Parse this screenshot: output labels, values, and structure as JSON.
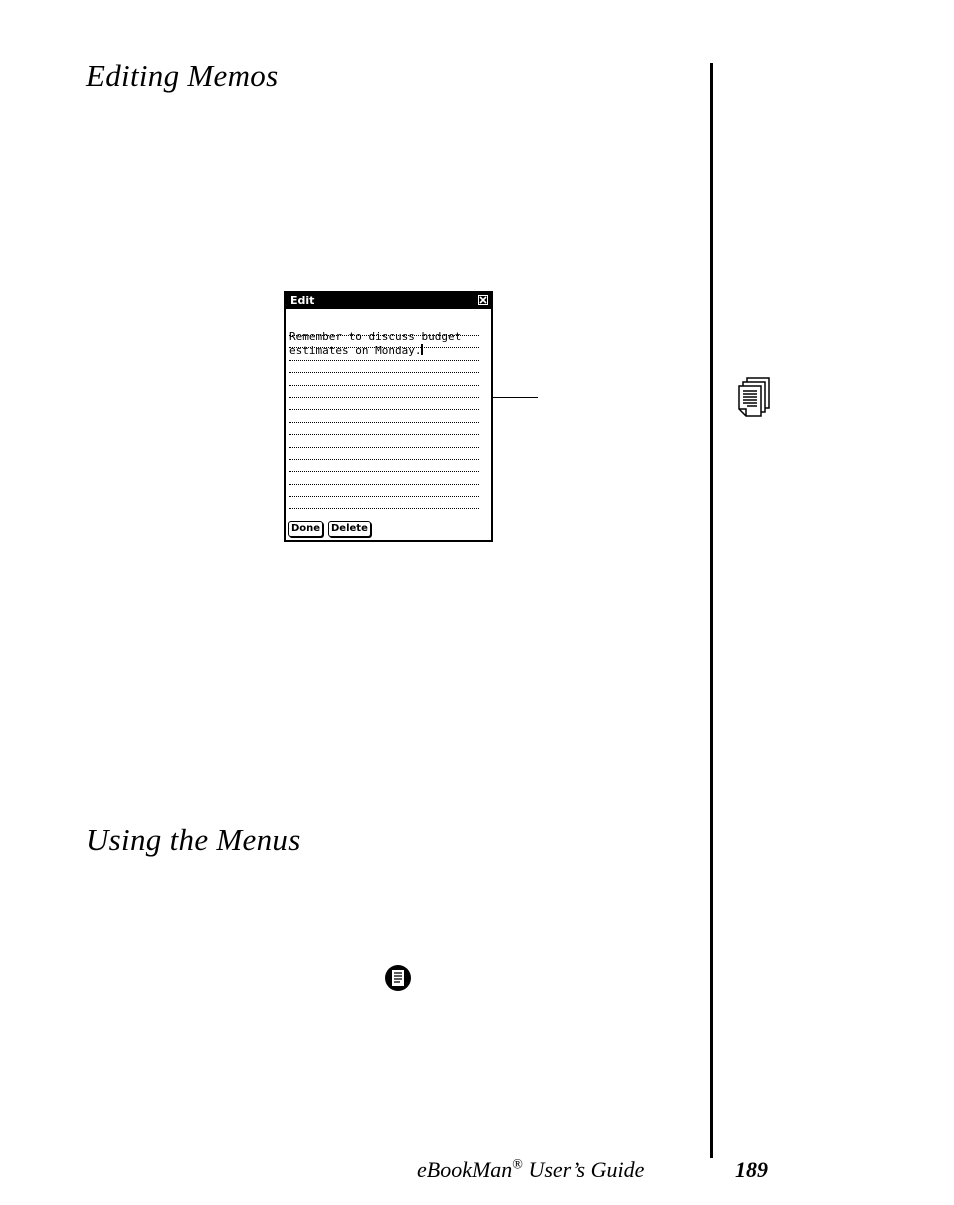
{
  "headings": {
    "editing": "Editing Memos",
    "menus": "Using the Menus"
  },
  "device": {
    "title": "Edit",
    "memo_line1": "Remember to discuss budget",
    "memo_line2": "estimates on Monday.",
    "done_label": "Done",
    "delete_label": "Delete"
  },
  "icons": {
    "doc": "stacked-document-icon",
    "menu": "menu-icon",
    "close": "close-icon"
  },
  "footer": {
    "guide_prefix": "eBookMan",
    "registered": "®",
    "guide_suffix": " User’s Guide",
    "page_number": "189"
  }
}
